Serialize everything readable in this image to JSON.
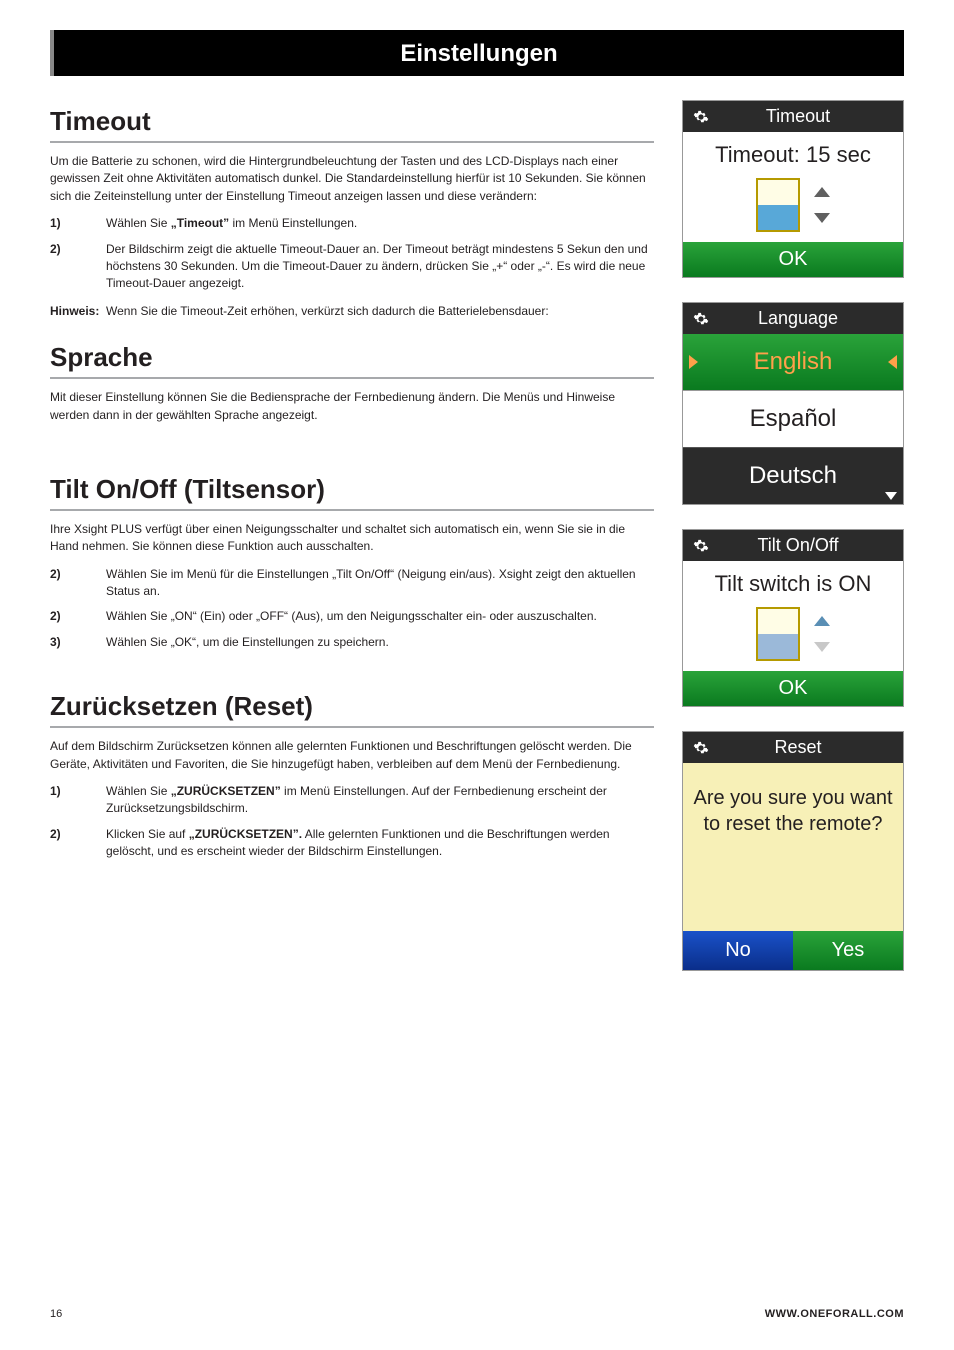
{
  "banner": "Einstellungen",
  "page_number": "16",
  "footer_url": "WWW.ONEFORALL.COM",
  "sections": {
    "timeout": {
      "title": "Timeout",
      "intro": "Um die Batterie zu schonen, wird die Hintergrundbeleuchtung der Tasten und des LCD-Displays nach einer gewissen Zeit ohne Aktivitäten automatisch dunkel. Die Standardeinstellung hierfür ist 10 Sekunden. Sie können sich die Zeiteinstellung unter der Einstellung Timeout anzeigen lassen und diese verändern:",
      "step1_num": "1)",
      "step1_a": "Wählen Sie ",
      "step1_b": "„Timeout”",
      "step1_c": " im Menü Einstellungen.",
      "step2_num": "2)",
      "step2": "Der Bildschirm zeigt die aktuelle Timeout-Dauer an. Der Timeout beträgt mindestens 5 Sekun den und höchstens 30 Sekunden. Um die Timeout-Dauer zu ändern, drücken Sie „+“ oder „-“. Es wird die neue Timeout-Dauer angezeigt.",
      "note_label": "Hinweis:",
      "note_text": "Wenn Sie die Timeout-Zeit erhöhen, verkürzt sich dadurch die Batterielebensdauer:"
    },
    "sprache": {
      "title": "Sprache",
      "intro": "Mit dieser Einstellung können Sie die Bediensprache der Fernbedienung ändern. Die Menüs und Hinweise werden dann in der gewählten Sprache angezeigt."
    },
    "tilt": {
      "title": "Tilt On/Off (Tiltsensor)",
      "intro": "Ihre Xsight PLUS verfügt über einen Neigungsschalter und schaltet sich automatisch ein, wenn Sie sie in die Hand nehmen. Sie können diese Funktion auch ausschalten.",
      "step1_num": "2)",
      "step1": "Wählen Sie im Menü für die Einstellungen „Tilt On/Off“ (Neigung ein/aus). Xsight zeigt den aktuellen Status an.",
      "step2_num": "2)",
      "step2": "Wählen Sie „ON“ (Ein) oder „OFF“ (Aus), um den Neigungsschalter ein- oder auszuschalten.",
      "step3_num": "3)",
      "step3": "Wählen Sie „OK“, um die Einstellungen zu speichern."
    },
    "reset": {
      "title": "Zurücksetzen (Reset)",
      "intro": "Auf dem Bildschirm Zurücksetzen können alle gelernten Funktionen und Beschriftungen gelöscht werden. Die Geräte, Aktivitäten und Favoriten, die Sie hinzugefügt haben, verbleiben auf dem Menü der Fernbedienung.",
      "step1_num": "1)",
      "step1_a": "Wählen Sie ",
      "step1_b": "„ZURÜCKSETZEN”",
      "step1_c": "  im Menü Einstellungen. Auf der Fernbedienung erscheint der Zurücksetzungsbildschirm.",
      "step2_num": "2)",
      "step2_a": "Klicken Sie auf ",
      "step2_b": "„ZURÜCKSETZEN”.",
      "step2_c": " Alle gelernten Funktionen und die Beschriftungen werden gelöscht, und es erscheint wieder der Bildschirm Einstellungen."
    }
  },
  "screens": {
    "timeout": {
      "head": "Timeout",
      "sub": "Timeout: 15 sec",
      "ok": "OK"
    },
    "language": {
      "head": "Language",
      "opt1": "English",
      "opt2": "Español",
      "opt3": "Deutsch"
    },
    "tilt": {
      "head": "Tilt On/Off",
      "sub": "Tilt switch is ON",
      "ok": "OK"
    },
    "reset": {
      "head": "Reset",
      "body": "Are you sure you want to reset the remote?",
      "no": "No",
      "yes": "Yes"
    }
  }
}
